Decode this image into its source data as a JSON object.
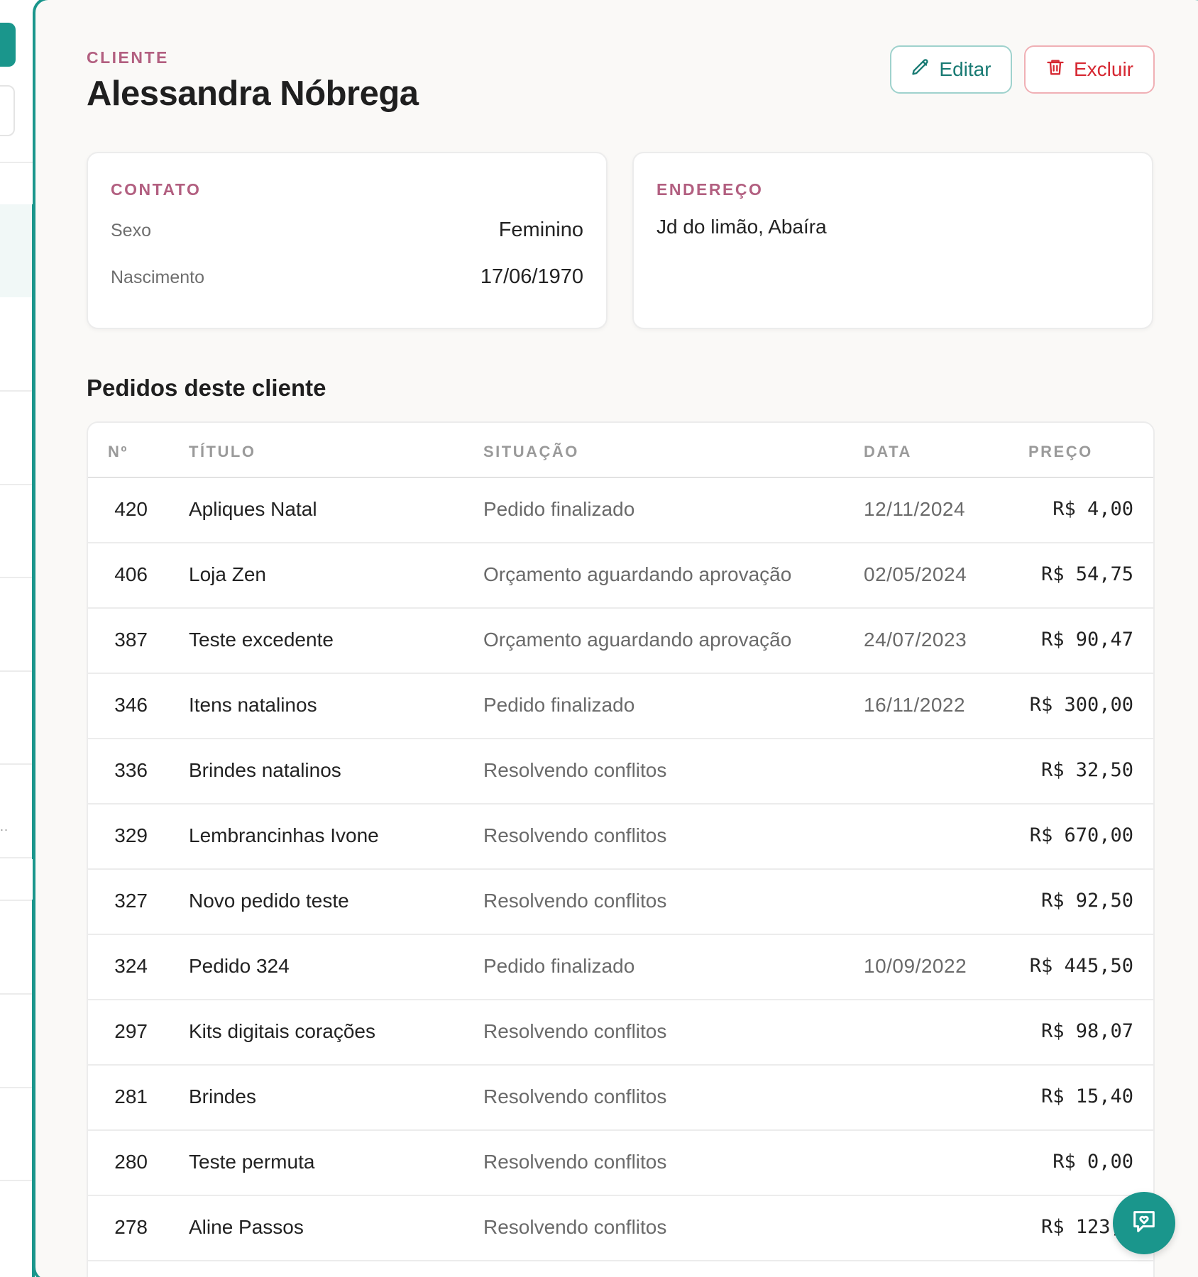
{
  "header": {
    "eyebrow": "CLIENTE",
    "client_name": "Alessandra Nóbrega",
    "edit_label": "Editar",
    "delete_label": "Excluir"
  },
  "contact": {
    "eyebrow": "CONTATO",
    "fields": [
      {
        "label": "Sexo",
        "value": "Feminino"
      },
      {
        "label": "Nascimento",
        "value": "17/06/1970"
      }
    ]
  },
  "address": {
    "eyebrow": "ENDEREÇO",
    "text": "Jd do limão, Abaíra"
  },
  "orders": {
    "title": "Pedidos deste cliente",
    "columns": [
      "Nº",
      "TÍTULO",
      "SITUAÇÃO",
      "DATA",
      "PREÇO"
    ],
    "rows": [
      {
        "num": "420",
        "title": "Apliques Natal",
        "status": "Pedido finalizado",
        "date": "12/11/2024",
        "price": "R$ 4,00"
      },
      {
        "num": "406",
        "title": "Loja Zen",
        "status": "Orçamento aguardando aprovação",
        "date": "02/05/2024",
        "price": "R$ 54,75"
      },
      {
        "num": "387",
        "title": "Teste excedente",
        "status": "Orçamento aguardando aprovação",
        "date": "24/07/2023",
        "price": "R$ 90,47"
      },
      {
        "num": "346",
        "title": "Itens natalinos",
        "status": "Pedido finalizado",
        "date": "16/11/2022",
        "price": "R$ 300,00"
      },
      {
        "num": "336",
        "title": "Brindes natalinos",
        "status": "Resolvendo conflitos",
        "date": "",
        "price": "R$ 32,50"
      },
      {
        "num": "329",
        "title": "Lembrancinhas Ivone",
        "status": "Resolvendo conflitos",
        "date": "",
        "price": "R$ 670,00"
      },
      {
        "num": "327",
        "title": "Novo pedido teste",
        "status": "Resolvendo conflitos",
        "date": "",
        "price": "R$ 92,50"
      },
      {
        "num": "324",
        "title": "Pedido 324",
        "status": "Pedido finalizado",
        "date": "10/09/2022",
        "price": "R$ 445,50"
      },
      {
        "num": "297",
        "title": "Kits digitais corações",
        "status": "Resolvendo conflitos",
        "date": "",
        "price": "R$ 98,07"
      },
      {
        "num": "281",
        "title": "Brindes",
        "status": "Resolvendo conflitos",
        "date": "",
        "price": "R$ 15,40"
      },
      {
        "num": "280",
        "title": "Teste permuta",
        "status": "Resolvendo conflitos",
        "date": "",
        "price": "R$ 0,00"
      },
      {
        "num": "278",
        "title": "Aline Passos",
        "status": "Resolvendo conflitos",
        "date": "",
        "price": "R$ 123,2"
      }
    ]
  },
  "sidebar": {
    "ellipsis": ".."
  },
  "icons": {
    "edit": "pencil-icon",
    "delete": "trash-icon",
    "fab": "chat-heart-icon"
  },
  "colors": {
    "accent": "#1a968c",
    "eyebrow": "#b25f80",
    "danger": "#d62832",
    "panel_bg": "#faf9f7"
  }
}
